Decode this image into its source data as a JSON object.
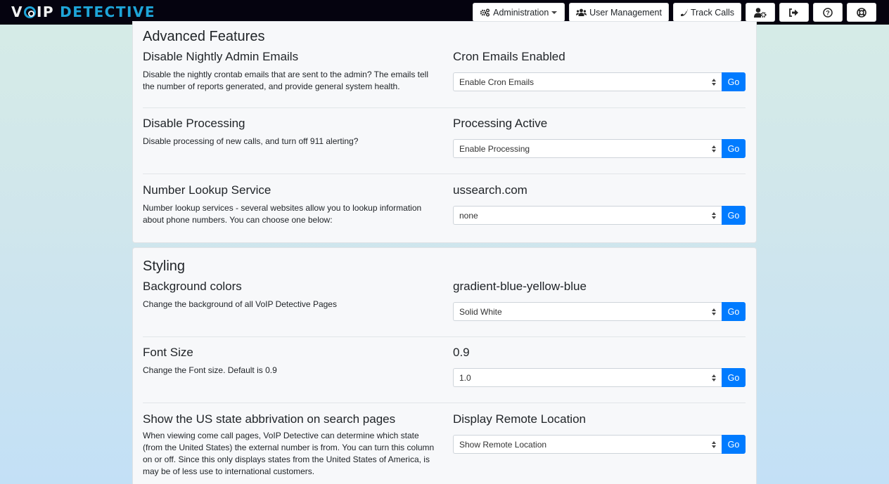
{
  "navbar": {
    "logo_part1": "V",
    "logo_part2": "IP",
    "logo_part3": "DETECTIVE",
    "buttons": [
      {
        "label": "Administration",
        "icon": "cogs-icon",
        "dropdown": true
      },
      {
        "label": "User Management",
        "icon": "users-icon"
      },
      {
        "label": "Track Calls",
        "icon": "phone-icon"
      },
      {
        "label": "",
        "icon": "user-cog-icon"
      },
      {
        "label": "",
        "icon": "sign-out-icon"
      },
      {
        "label": "",
        "icon": "question-circle-icon"
      },
      {
        "label": "",
        "icon": "life-ring-icon"
      }
    ]
  },
  "sections": [
    {
      "title": "Advanced Features",
      "settings": [
        {
          "heading": "Disable Nightly Admin Emails",
          "description": "Disable the nightly crontab emails that are sent to the admin? The emails tell the number of reports generated, and provide general system health.",
          "status": "Cron Emails Enabled",
          "selected": "Enable Cron Emails",
          "button": "Go"
        },
        {
          "heading": "Disable Processing",
          "description": "Disable processing of new calls, and turn off 911 alerting?",
          "status": "Processing Active",
          "selected": "Enable Processing",
          "button": "Go"
        },
        {
          "heading": "Number Lookup Service",
          "description": "Number lookup services - several websites allow you to lookup information about phone numbers. You can choose one below:",
          "status": "ussearch.com",
          "selected": "none",
          "button": "Go"
        }
      ]
    },
    {
      "title": "Styling",
      "settings": [
        {
          "heading": "Background colors",
          "description": "Change the background of all VoIP Detective Pages",
          "status": "gradient-blue-yellow-blue",
          "selected": "Solid White",
          "button": "Go"
        },
        {
          "heading": "Font Size",
          "description": "Change the Font size. Default is 0.9",
          "status": "0.9",
          "selected": "1.0",
          "button": "Go"
        },
        {
          "heading": "Show the US state abbrivation on search pages",
          "description": "When viewing come call pages, VoIP Detective can determine which state (from the United States) the external number is from. You can turn this column on or off. Since this only displays states from the United States of America, is may be of less use to international customers.",
          "status": "Display Remote Location",
          "selected": "Show Remote Location",
          "button": "Go"
        }
      ]
    }
  ],
  "colors": {
    "navbar_bg": "#05030f",
    "brand_blue": "#1ea5d8",
    "primary_button": "#007bff",
    "card_bg": "#f7f8fa"
  }
}
